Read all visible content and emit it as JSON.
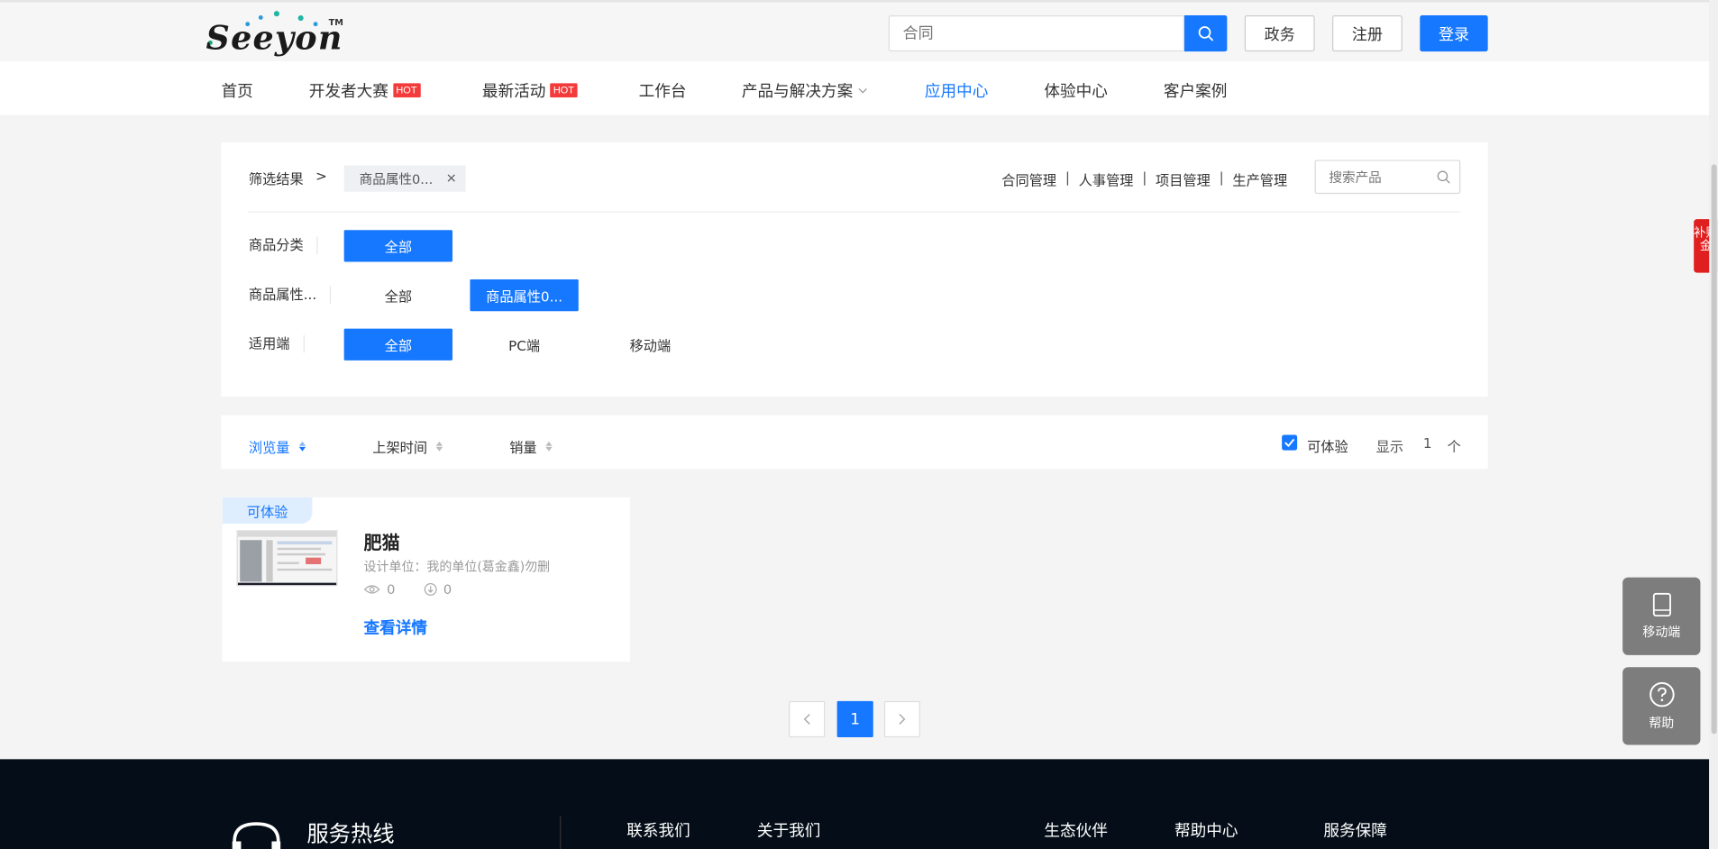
{
  "brand": {
    "logo_text": "Seeyon",
    "tm": "TM"
  },
  "search": {
    "placeholder": "合同"
  },
  "top_buttons": {
    "gov": "政务",
    "register": "注册",
    "login": "登录"
  },
  "nav": [
    {
      "label": "首页",
      "hot": ""
    },
    {
      "label": "开发者大赛",
      "hot": "HOT"
    },
    {
      "label": "最新活动",
      "hot": "HOT"
    },
    {
      "label": "工作台",
      "hot": ""
    },
    {
      "label": "产品与解决方案",
      "hot": ""
    },
    {
      "label": "应用中心",
      "hot": ""
    },
    {
      "label": "体验中心",
      "hot": ""
    },
    {
      "label": "客户案例",
      "hot": ""
    }
  ],
  "filter": {
    "result_label": "筛选结果",
    "arrow": ">",
    "active_tag": "商品属性0...",
    "tag_close": "×",
    "quick_links": [
      "合同管理",
      "人事管理",
      "项目管理",
      "生产管理"
    ],
    "search_placeholder": "搜索产品",
    "rows": [
      {
        "label": "商品分类",
        "options": [
          "全部"
        ],
        "selected": 0
      },
      {
        "label": "商品属性...",
        "options": [
          "全部",
          "商品属性0..."
        ],
        "selected": 1
      },
      {
        "label": "适用端",
        "options": [
          "全部",
          "PC端",
          "移动端"
        ],
        "selected": 0
      }
    ]
  },
  "sort": {
    "items": [
      "浏览量",
      "上架时间",
      "销量"
    ],
    "active": 0,
    "experience_label": "可体验",
    "show_label": "显示",
    "count": "1",
    "unit": "个"
  },
  "products": [
    {
      "badge": "可体验",
      "title": "肥猫",
      "designer": "设计单位：我的单位(葛金鑫)勿删",
      "views": "0",
      "downloads": "0",
      "link": "查看详情"
    }
  ],
  "pagination": {
    "prev": "‹",
    "current": "1",
    "next": "›"
  },
  "footer": {
    "hotline": "服务热线",
    "links": [
      "联系我们",
      "关于我们",
      "生态伙伴",
      "帮助中心",
      "服务保障"
    ]
  },
  "side": {
    "subsidy": "补贴金",
    "mobile": "移动端",
    "help": "帮助"
  },
  "colors": {
    "primary": "#1677ff",
    "hot": "#f43b3b",
    "footer_bg": "#050e18"
  }
}
